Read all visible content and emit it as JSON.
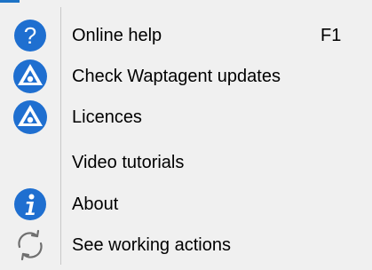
{
  "menu": {
    "items": [
      {
        "label": "Online help",
        "shortcut": "F1",
        "icon": "help-icon"
      },
      {
        "label": "Check Waptagent updates",
        "icon": "wapt-logo-icon"
      },
      {
        "label": "Licences",
        "icon": "wapt-logo-icon"
      },
      {
        "label": "Video tutorials",
        "icon": ""
      },
      {
        "label": "About",
        "icon": "info-icon"
      },
      {
        "label": "See working actions",
        "icon": "refresh-icon"
      }
    ]
  },
  "colors": {
    "background": "#f0f0f0",
    "accent": "#1e73c6",
    "icon_blue": "#1f6fd0",
    "separator": "#c8c8c8"
  }
}
